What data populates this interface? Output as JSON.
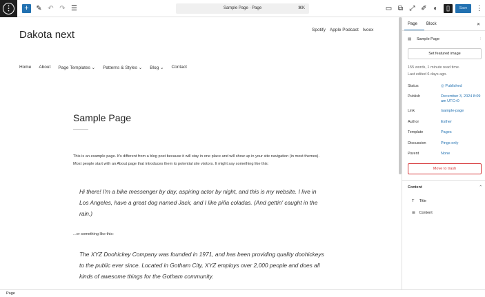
{
  "toolbar": {
    "command_title": "Sample Page · Page",
    "shortcut": "⌘K",
    "save_label": "Save"
  },
  "site": {
    "title": "Dakota next",
    "social": [
      "Spotify",
      "Apple Podcast",
      "Ivoox"
    ],
    "nav": [
      "Home",
      "About",
      "Page Templates ⌄",
      "Patterns & Styles ⌄",
      "Blog ⌄",
      "Contact"
    ]
  },
  "page": {
    "title": "Sample Page",
    "intro": "This is an example page. It's different from a blog post because it will stay in one place and will show up in your site navigation (in most themes). Most people start with an About page that introduces them to potential site visitors. It might say something like this:",
    "quote1": "Hi there! I'm a bike messenger by day, aspiring actor by night, and this is my website. I live in Los Angeles, have a great dog named Jack, and I like piña coladas. (And gettin' caught in the rain.)",
    "between": "...or something like this:",
    "quote2": "The XYZ Doohickey Company was founded in 1971, and has been providing quality doohickeys to the public ever since. Located in Gotham City, XYZ employs over 2,000 people and does all kinds of awesome things for the Gotham community."
  },
  "sidebar": {
    "tab_page": "Page",
    "tab_block": "Block",
    "doc_title": "Sample Page",
    "featured": "Set featured image",
    "meta1": "155 words, 1 minute read time.",
    "meta2": "Last edited 6 days ago.",
    "rows": [
      {
        "label": "Status",
        "value": "Published"
      },
      {
        "label": "Publish",
        "value": "December 3, 2024 8:09 am UTC+0"
      },
      {
        "label": "Link",
        "value": "/sample-page"
      },
      {
        "label": "Author",
        "value": "Esther"
      },
      {
        "label": "Template",
        "value": "Pages"
      },
      {
        "label": "Discussion",
        "value": "Pings only"
      },
      {
        "label": "Parent",
        "value": "None"
      }
    ],
    "trash": "Move to trash",
    "content_heading": "Content",
    "content_items": [
      "Title",
      "Content"
    ]
  },
  "statusbar": {
    "label": "Page"
  }
}
